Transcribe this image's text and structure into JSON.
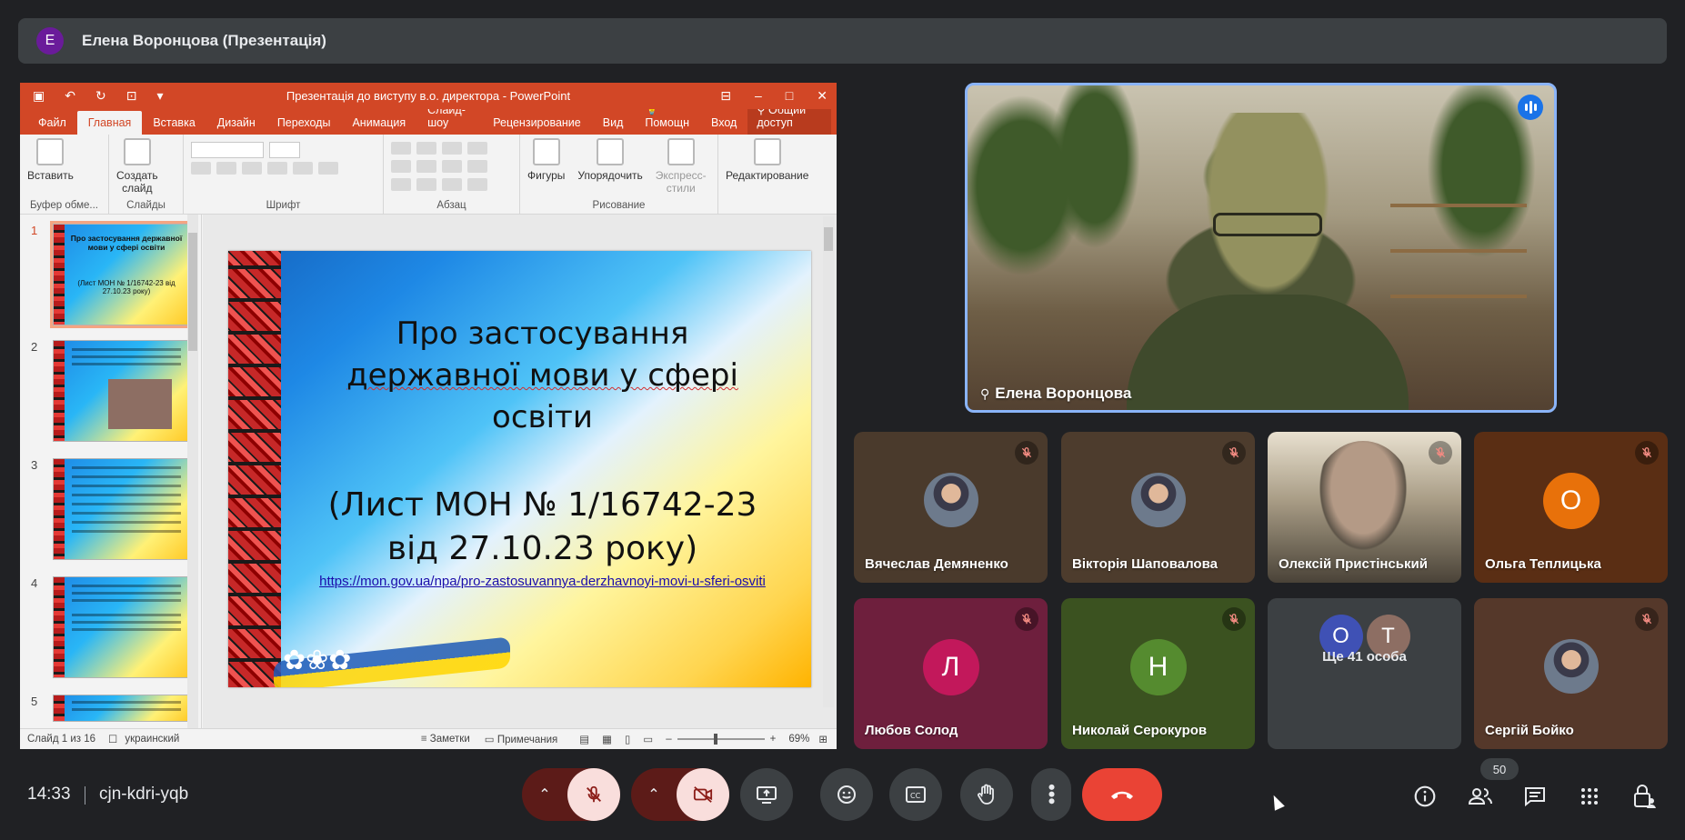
{
  "topbar": {
    "avatar_letter": "E",
    "title": "Елена Воронцова (Презентація)",
    "avatar_color": "#6a1b9a"
  },
  "powerpoint": {
    "window_title": "Презентація до виступу в.о. директора - PowerPoint",
    "tabs": [
      "Файл",
      "Главная",
      "Вставка",
      "Дизайн",
      "Переходы",
      "Анимация",
      "Слайд-шоу",
      "Рецензирование",
      "Вид"
    ],
    "active_tab": "Главная",
    "help": "Помощн",
    "signin": "Вход",
    "share": "Общий доступ",
    "ribbon": {
      "paste": "Вставить",
      "new_slide_1": "Создать",
      "new_slide_2": "слайд",
      "shapes": "Фигуры",
      "arrange": "Упорядочить",
      "styles_1": "Экспресс-",
      "styles_2": "стили",
      "editing": "Редактирование",
      "groups": [
        "Буфер обме...",
        "Слайды",
        "Шрифт",
        "Абзац",
        "Рисование"
      ]
    },
    "thumbnails": [
      {
        "num": "1",
        "title": "Про застосування державної мови у сфері освіти",
        "sub": "(Лист МОН № 1/16742-23 від 27.10.23 року)"
      },
      {
        "num": "2",
        "title": "",
        "sub": ""
      },
      {
        "num": "3",
        "title": "",
        "sub": ""
      },
      {
        "num": "4",
        "title": "",
        "sub": ""
      },
      {
        "num": "5",
        "title": "",
        "sub": ""
      }
    ],
    "slide": {
      "title_line1": "Про застосування",
      "title_line2": "державної мови у сфері",
      "title_line3": "освіти",
      "letter_line1": "(Лист МОН № 1/16742-23",
      "letter_line2": "від 27.10.23 року)",
      "link": "https://mon.gov.ua/npa/pro-zastosuvannya-derzhavnoyi-movi-u-sferi-osviti"
    },
    "status": {
      "slide_of": "Слайд 1 из 16",
      "language": "украинский",
      "notes": "Заметки",
      "comments": "Примечания",
      "zoom": "69%"
    },
    "accent": "#d24726"
  },
  "main_video": {
    "name": "Елена Воронцова",
    "border_color": "#8ab4f8"
  },
  "participants": [
    {
      "name": "Вячеслав Демяненко",
      "kind": "photo",
      "bg": "#4a3a2c"
    },
    {
      "name": "Вікторія Шаповалова",
      "kind": "photo",
      "bg": "#4d3c2d"
    },
    {
      "name": "Олексій Пристінський",
      "kind": "video",
      "bg": "#3b3a36"
    },
    {
      "name": "Ольга Теплицька",
      "kind": "letter",
      "letter": "О",
      "bg": "#5a2e14",
      "circle": "#e8710a"
    },
    {
      "name": "Любов Солод",
      "kind": "letter",
      "letter": "Л",
      "bg": "#6e1f3d",
      "circle": "#c2185b"
    },
    {
      "name": "Николай Серокуров",
      "kind": "letter",
      "letter": "Н",
      "bg": "#3b5220",
      "circle": "#558b2f"
    },
    {
      "name": "Ще 41 особа",
      "kind": "more",
      "bg": "#3c4043",
      "av1": "О",
      "av2": "Т"
    },
    {
      "name": "Сергій Бойко",
      "kind": "photo",
      "bg": "#55382a"
    }
  ],
  "bottom": {
    "time": "14:33",
    "meeting_code": "cjn-kdri-yqb",
    "participant_count": "50"
  }
}
